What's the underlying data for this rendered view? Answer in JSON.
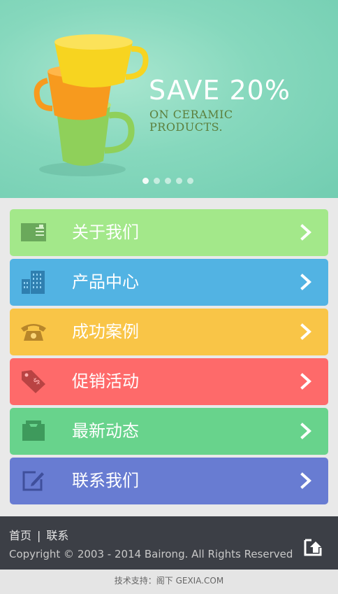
{
  "banner": {
    "headline": "SAVE 20%",
    "subline": "ON CERAMIC PRODUCTS.",
    "slides": [
      true,
      false,
      false,
      false,
      false
    ]
  },
  "menu": {
    "items": [
      {
        "label": "关于我们",
        "color": "#a3e88a",
        "iconColor": "#6aa85b",
        "icon": "id-card-icon",
        "name": "menu-item-about"
      },
      {
        "label": "产品中心",
        "color": "#52b3e3",
        "iconColor": "#2f7fb0",
        "icon": "buildings-icon",
        "name": "menu-item-products"
      },
      {
        "label": "成功案例",
        "color": "#f9c547",
        "iconColor": "#b8862a",
        "icon": "telephone-icon",
        "name": "menu-item-cases"
      },
      {
        "label": "促销活动",
        "color": "#fe6a6a",
        "iconColor": "#b94343",
        "icon": "price-tag-icon",
        "name": "menu-item-promotions"
      },
      {
        "label": "最新动态",
        "color": "#68d38c",
        "iconColor": "#3e9a5c",
        "icon": "inbox-icon",
        "name": "menu-item-news"
      },
      {
        "label": "联系我们",
        "color": "#687cd2",
        "iconColor": "#3f4f9c",
        "icon": "edit-icon",
        "name": "menu-item-contact"
      }
    ]
  },
  "footer": {
    "home": "首页",
    "separator": "|",
    "contact": "联系",
    "copyright": "Copyright © 2003 - 2014 Bairong. All Rights Reserved"
  },
  "support": {
    "text": "技术支持：阁下 GEXIA.COM"
  }
}
